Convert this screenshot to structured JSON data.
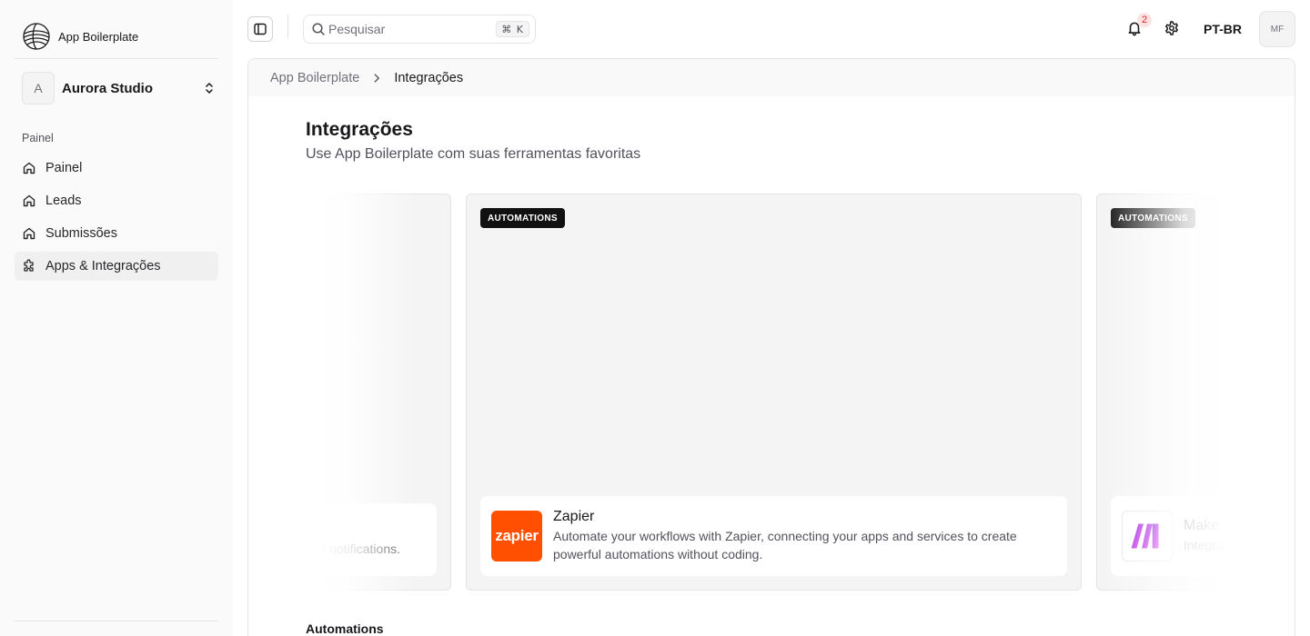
{
  "app": {
    "name": "App Boilerplate"
  },
  "org": {
    "initial": "A",
    "name": "Aurora Studio"
  },
  "sidebar": {
    "section": "Painel",
    "items": [
      {
        "label": "Painel",
        "icon": "home-icon",
        "active": false
      },
      {
        "label": "Leads",
        "icon": "home-icon",
        "active": false
      },
      {
        "label": "Submissões",
        "icon": "home-icon",
        "active": false
      },
      {
        "label": "Apps & Integrações",
        "icon": "puzzle-icon",
        "active": true
      }
    ]
  },
  "topbar": {
    "search_placeholder": "Pesquisar",
    "search_shortcut": "⌘ K",
    "notification_count": "2",
    "language": "PT-BR",
    "user_initials": "MF"
  },
  "breadcrumb": {
    "parent": "App Boilerplate",
    "current": "Integrações"
  },
  "page": {
    "title": "Integrações",
    "subtitle": "Use App Boilerplate com suas ferramentas favoritas"
  },
  "carousel": {
    "cards": [
      {
        "tag": "",
        "title": "",
        "description": "t notifications."
      },
      {
        "tag": "AUTOMATIONS",
        "logo_text": "zapier",
        "title": "Zapier",
        "description": "Automate your workflows with Zapier, connecting your apps and services to create powerful automations without coding."
      },
      {
        "tag": "AUTOMATIONS",
        "title": "Make",
        "description": "Integrate"
      }
    ]
  },
  "sections": {
    "automations_label": "Automations"
  },
  "colors": {
    "zapier": "#ff4f00",
    "make_gradient": [
      "#6d00cc",
      "#f024f6"
    ],
    "badge_bg": "#fde2e2",
    "badge_text": "#dc2626"
  }
}
